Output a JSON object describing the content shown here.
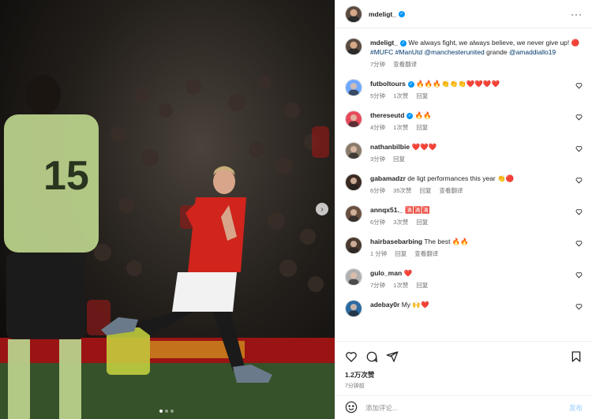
{
  "post": {
    "author": "mdeligt_",
    "caption_text": "We always fight, we always believe, we never give up! 🔴 ",
    "hashtag_mufc": "#MUFC",
    "hashtag_manutd": "#ManUtd",
    "mention_club": "@manchesterunited",
    "caption_tail": " grande",
    "mention_player": "@amaddiallo19",
    "caption_time": "7分钟",
    "see_translation": "查看翻译",
    "likes": "1.2万次赞",
    "time_ago": "7分钟前",
    "comment_placeholder": "添加评论...",
    "post_label": "发布"
  },
  "comments": [
    {
      "user": "futboltours",
      "verified": true,
      "text": "🔥🔥🔥👏👏👏❤️❤️❤️❤️",
      "time": "5分钟",
      "likes": "1次赞",
      "reply": "回复",
      "translate": ""
    },
    {
      "user": "thereseutd",
      "verified": true,
      "text": "🔥🔥",
      "time": "4分钟",
      "likes": "1次赞",
      "reply": "回复",
      "translate": ""
    },
    {
      "user": "nathanbilbie",
      "verified": false,
      "text": "❤️❤️❤️",
      "time": "3分钟",
      "likes": "",
      "reply": "回复",
      "translate": ""
    },
    {
      "user": "gabamadzr",
      "verified": false,
      "text": "de ligt performances this year 👏🔴",
      "time": "6分钟",
      "likes": "35次赞",
      "reply": "回复",
      "translate": "查看翻译"
    },
    {
      "user": "annqx51._",
      "verified": false,
      "text": "🈵🈵🈵",
      "time": "6分钟",
      "likes": "3次赞",
      "reply": "回复",
      "translate": ""
    },
    {
      "user": "hairbasebarbing",
      "verified": false,
      "text": "The best 🔥🔥",
      "time": "1 分钟",
      "likes": "",
      "reply": "回复",
      "translate": "查看翻译"
    },
    {
      "user": "gulo_man",
      "verified": false,
      "text": "❤️",
      "time": "7分钟",
      "likes": "1次赞",
      "reply": "回复",
      "translate": ""
    },
    {
      "user": "adebay0r",
      "verified": false,
      "text": "My 🙌❤️",
      "time": "",
      "likes": "",
      "reply": "",
      "translate": ""
    }
  ],
  "photo": {
    "jersey_number": "15"
  },
  "colors": {
    "verified": "#0095f6",
    "link": "#00376b",
    "muted": "#737373"
  },
  "icons": [
    "more-options-icon",
    "verified-icon",
    "heart-icon",
    "comment-icon",
    "share-icon",
    "save-icon",
    "emoji-icon",
    "next-arrow-icon"
  ]
}
